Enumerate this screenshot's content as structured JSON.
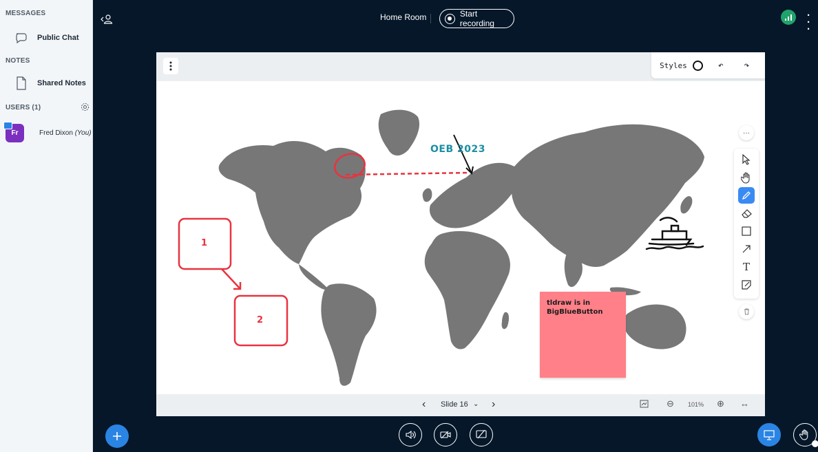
{
  "sidebar": {
    "messages_label": "MESSAGES",
    "public_chat": "Public Chat",
    "notes_label": "NOTES",
    "shared_notes": "Shared Notes",
    "users_label": "USERS (1)",
    "user": {
      "initials": "Fr",
      "name": "Fred Dixon",
      "you_tag": "(You)"
    }
  },
  "topbar": {
    "room_title": "Home Room",
    "record_label": "Start recording"
  },
  "whiteboard": {
    "styles_label": "Styles",
    "more_label": "···",
    "annotations": {
      "oeb": "OEB 2023",
      "box1": "1",
      "box2": "2",
      "note": "tldraw is in\nBigBlueButton"
    },
    "footer": {
      "slide_label": "Slide 16",
      "zoom": "101%"
    }
  },
  "colors": {
    "brand_dark": "#06172a",
    "accent_blue": "#2a84e3",
    "connection_green": "#21a36b",
    "annotation_red": "#e8333f",
    "annotation_teal": "#1b8fa3",
    "sticky_note": "#ff8088",
    "map_land": "#777777"
  }
}
